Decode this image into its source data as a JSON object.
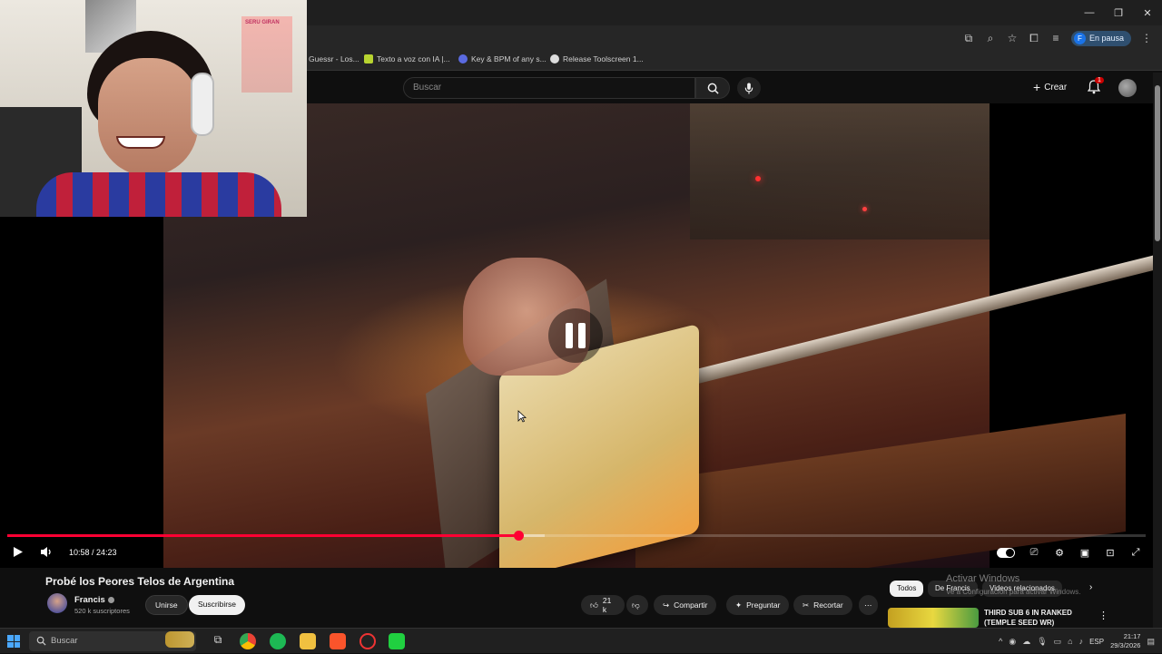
{
  "browser": {
    "profile_status": "En pausa",
    "profile_initial": "F",
    "bookmarks": [
      "Guessr - Los...",
      "Texto a voz con IA |...",
      "Key & BPM of any s...",
      "Release Toolscreen 1..."
    ]
  },
  "header": {
    "search_placeholder": "Buscar",
    "create_label": "Crear",
    "notifications_count": "1"
  },
  "webcam": {
    "poster_text": "SERU GIRAN"
  },
  "player": {
    "current_time": "10:58",
    "duration": "24:23",
    "time_display": "10:58 / 24:23",
    "progress_fraction": 0.449,
    "buffer_fraction": 0.472
  },
  "video": {
    "title": "Probé los Peores Telos de Argentina",
    "channel": "Francis",
    "subscribers": "520 k suscriptores",
    "join_label": "Unirse",
    "subscribe_label": "Suscribirse",
    "likes": "21 k",
    "share_label": "Compartir",
    "ask_label": "Preguntar",
    "clip_label": "Recortar"
  },
  "related": {
    "chips": [
      "Todos",
      "De Francis",
      "Videos relacionados"
    ],
    "watermark_title": "Activar Windows",
    "watermark_sub": "Ve a Configuración para activar Windows.",
    "first_title": "THIRD SUB 6 IN RANKED (TEMPLE SEED WR)"
  },
  "taskbar": {
    "search_placeholder": "Buscar",
    "language": "ESP",
    "time": "21:17",
    "date": "29/3/2026"
  },
  "colors": {
    "accent_red": "#ff0033",
    "background": "#0f0f0f"
  }
}
